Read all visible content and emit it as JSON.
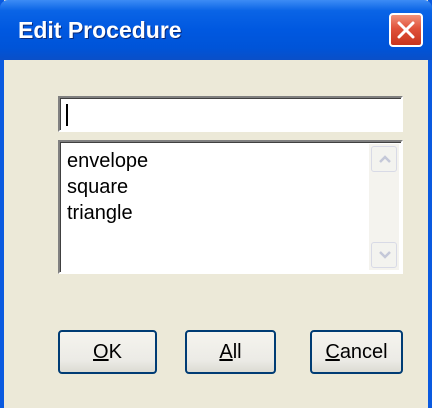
{
  "window": {
    "title": "Edit Procedure",
    "close_icon": "close-icon",
    "colors": {
      "titlebar": "#0058e0",
      "body": "#ece9d8",
      "close": "#e0523a"
    }
  },
  "input": {
    "value": ""
  },
  "list": {
    "items": [
      "envelope",
      "square",
      "triangle"
    ],
    "scroll_up_icon": "scroll-up-arrow-icon",
    "scroll_down_icon": "scroll-down-arrow-icon"
  },
  "buttons": {
    "ok": {
      "accel": "O",
      "rest": "K"
    },
    "all": {
      "accel": "A",
      "rest": "ll"
    },
    "cancel": {
      "accel": "C",
      "rest": "ancel"
    }
  }
}
